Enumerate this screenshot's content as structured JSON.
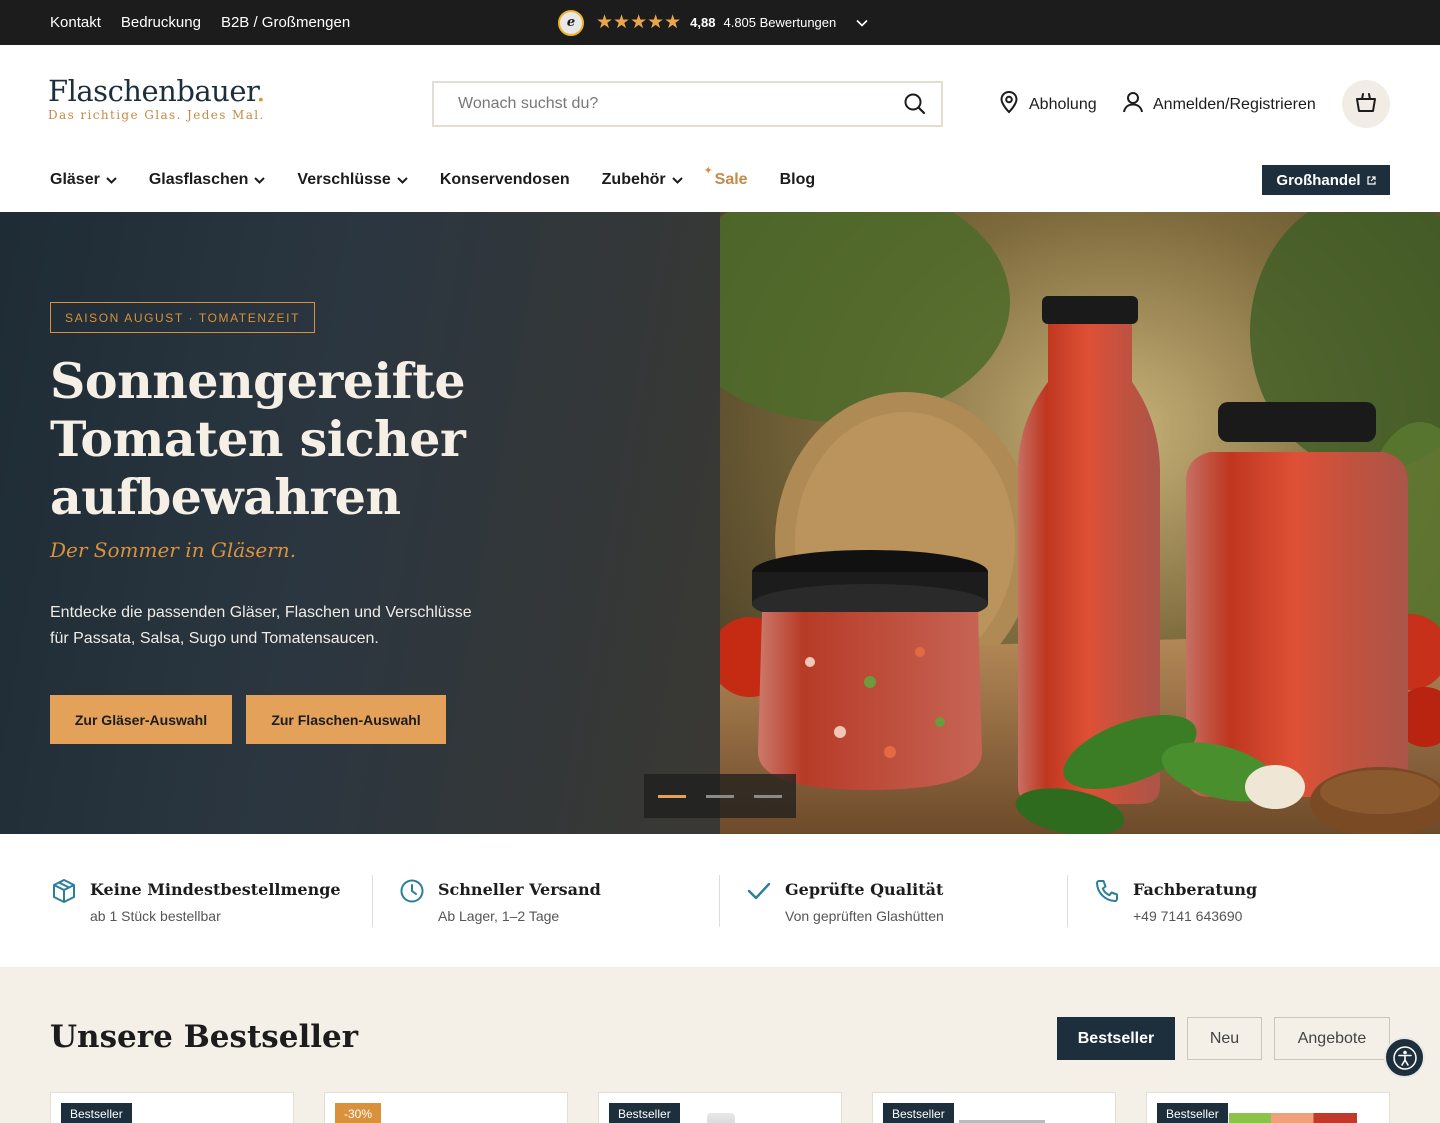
{
  "topbar": {
    "links": [
      "Kontakt",
      "Bedruckung",
      "B2B / Großmengen"
    ],
    "rating": {
      "stars": "★★★★★",
      "score": "4,88",
      "count": "4.805 Bewertungen",
      "badge_letter": "e"
    }
  },
  "header": {
    "logo_name": "Flaschenbauer",
    "logo_dot": ".",
    "logo_tagline": "Das richtige Glas. Jedes Mal.",
    "search_placeholder": "Wonach suchst du?",
    "pickup_label": "Abholung",
    "login_label": "Anmelden/Registrieren"
  },
  "nav": {
    "items": [
      "Gläser",
      "Glasflaschen",
      "Verschlüsse",
      "Konservendosen",
      "Zubehör",
      "Sale",
      "Blog"
    ],
    "sale_spark": "✦",
    "wholesale_label": "Großhandel"
  },
  "hero": {
    "season_label": "SAISON AUGUST · TOMATENZEIT",
    "title_lines": [
      "Sonnengereifte",
      "Tomaten sicher",
      "aufbewahren"
    ],
    "subtitle": "Der Sommer in Gläsern.",
    "text_lines": [
      "Entdecke die passenden Gläser, Flaschen und Verschlüsse",
      "für Passata, Salsa, Sugo und Tomatensaucen."
    ],
    "button_jars": "Zur Gläser-Auswahl",
    "button_bottles": "Zur Flaschen-Auswahl",
    "slides_active": 1,
    "slides_total": 3
  },
  "usps": [
    {
      "title": "Keine Mindestbestellmenge",
      "sub": "ab 1 Stück bestellbar",
      "icon": "box-icon"
    },
    {
      "title": "Schneller Versand",
      "sub": "Ab Lager, 1–2 Tage",
      "icon": "clock-icon"
    },
    {
      "title": "Geprüfte Qualität",
      "sub": "Von geprüften Glashütten",
      "icon": "check-icon"
    },
    {
      "title": "Fachberatung",
      "sub": "+49 7141 643690",
      "icon": "phone-icon"
    }
  ],
  "bestseller": {
    "title": "Unsere Bestseller",
    "tabs": [
      "Bestseller",
      "Neu",
      "Angebote"
    ],
    "cards": [
      {
        "badge": "Bestseller"
      },
      {
        "badge": "-30%"
      },
      {
        "badge": "Bestseller"
      },
      {
        "badge": "Bestseller"
      },
      {
        "badge": "Bestseller"
      }
    ]
  },
  "colors": {
    "accent": "#e3a15a",
    "navy": "#1d2f3d",
    "cream": "#f4efe7",
    "topbar": "#1c1c1c",
    "icon_teal": "#2a7f9e"
  }
}
